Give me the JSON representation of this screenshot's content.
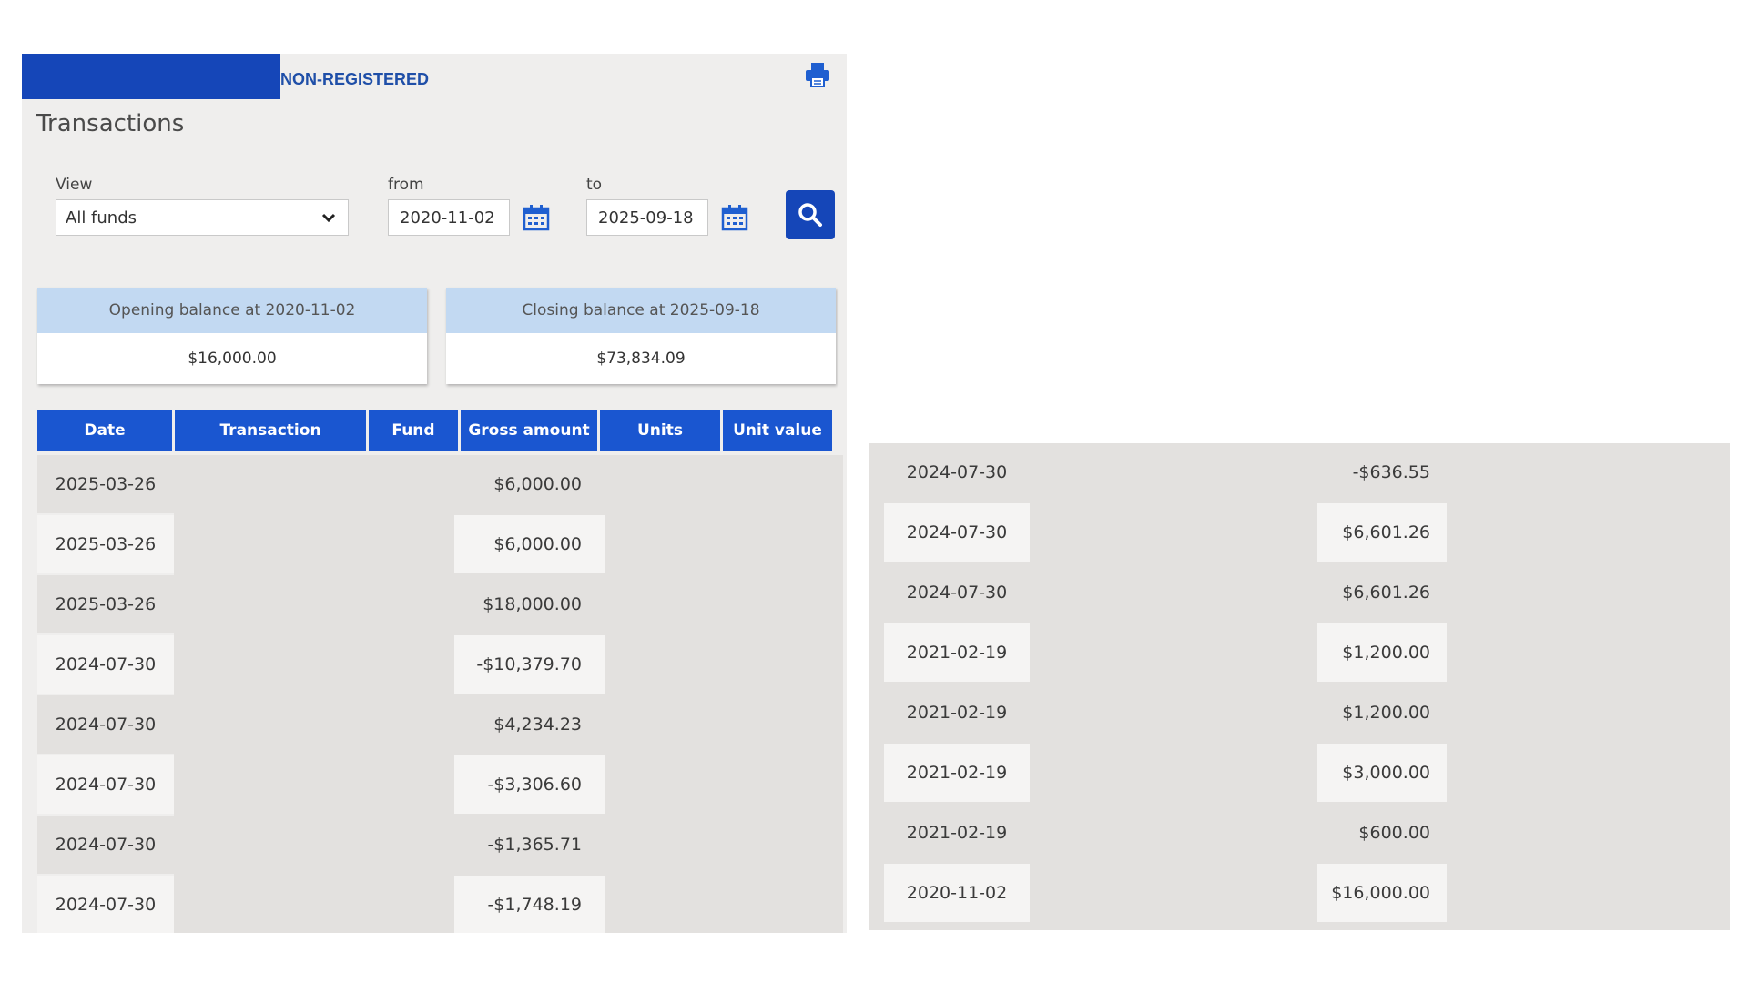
{
  "header": {
    "account_type": "NON-REGISTERED",
    "page_title": "Transactions"
  },
  "filters": {
    "view_label": "View",
    "view_value": "All funds",
    "from_label": "from",
    "from_value": "2020-11-02",
    "to_label": "to",
    "to_value": "2025-09-18"
  },
  "balances": {
    "opening_label": "Opening balance at 2020-11-02",
    "opening_value": "$16,000.00",
    "closing_label": "Closing balance at 2025-09-18",
    "closing_value": "$73,834.09"
  },
  "table": {
    "columns": [
      "Date",
      "Transaction",
      "Fund",
      "Gross amount",
      "Units",
      "Unit value"
    ],
    "rows_left": [
      {
        "date": "2025-03-26",
        "amount": "$6,000.00"
      },
      {
        "date": "2025-03-26",
        "amount": "$6,000.00"
      },
      {
        "date": "2025-03-26",
        "amount": "$18,000.00"
      },
      {
        "date": "2024-07-30",
        "amount": "-$10,379.70"
      },
      {
        "date": "2024-07-30",
        "amount": "$4,234.23"
      },
      {
        "date": "2024-07-30",
        "amount": "-$3,306.60"
      },
      {
        "date": "2024-07-30",
        "amount": "-$1,365.71"
      },
      {
        "date": "2024-07-30",
        "amount": "-$1,748.19"
      }
    ],
    "rows_right": [
      {
        "date": "2024-07-30",
        "amount": "-$636.55"
      },
      {
        "date": "2024-07-30",
        "amount": "$6,601.26"
      },
      {
        "date": "2024-07-30",
        "amount": "$6,601.26"
      },
      {
        "date": "2021-02-19",
        "amount": "$1,200.00"
      },
      {
        "date": "2021-02-19",
        "amount": "$1,200.00"
      },
      {
        "date": "2021-02-19",
        "amount": "$3,000.00"
      },
      {
        "date": "2021-02-19",
        "amount": "$600.00"
      },
      {
        "date": "2020-11-02",
        "amount": "$16,000.00"
      }
    ]
  },
  "colors": {
    "brand": "#1546b8",
    "header_blue": "#1a56d0",
    "balance_head": "#c2d9f2",
    "panel_bg": "#efeeed",
    "row_dark": "#e3e1df",
    "row_light": "#f5f4f3"
  },
  "icons": {
    "print": "print-icon",
    "calendar": "calendar-icon",
    "search": "search-icon",
    "dropdown": "chevron-down-icon"
  }
}
